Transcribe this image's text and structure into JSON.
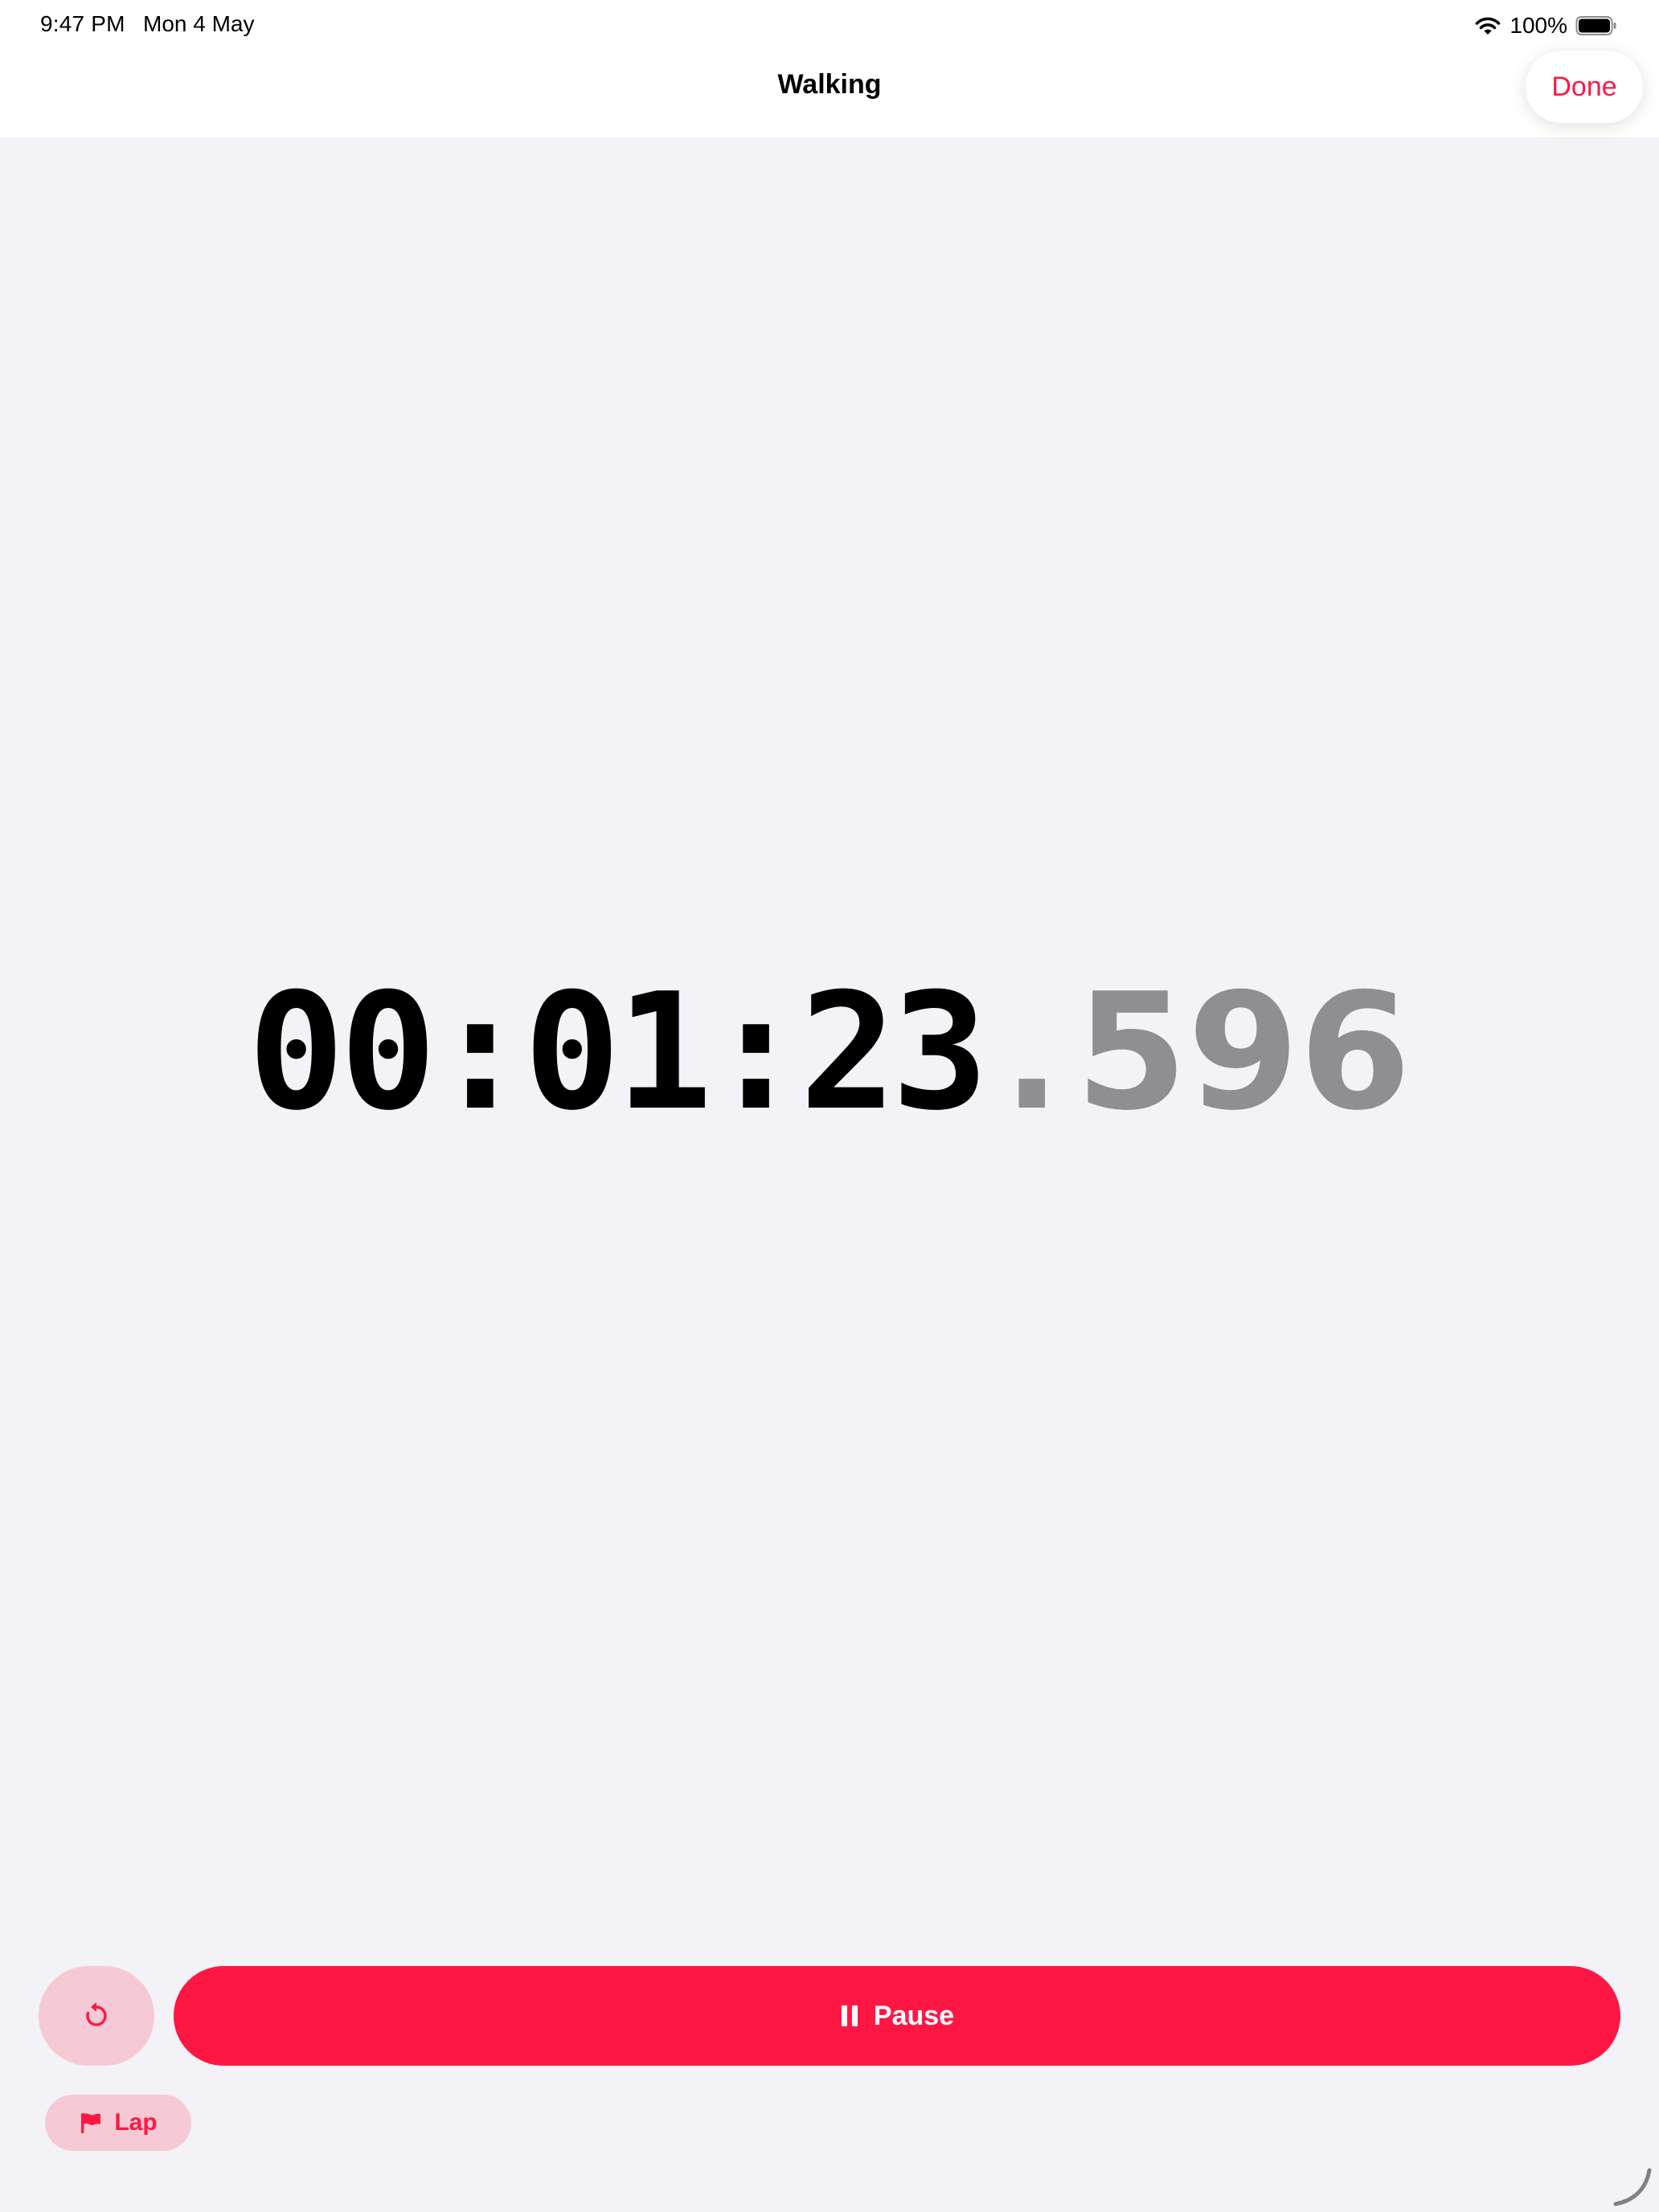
{
  "status_bar": {
    "time": "9:47 PM",
    "date": "Mon 4 May",
    "battery": "100%",
    "wifi_icon": "wifi-icon",
    "battery_icon": "battery-full-icon"
  },
  "nav": {
    "title": "Walking",
    "done_label": "Done"
  },
  "timer": {
    "main": "00:01:23",
    "separator": ".",
    "fraction": "596"
  },
  "controls": {
    "reset_icon": "reset-icon",
    "pause_label": "Pause",
    "pause_icon": "pause-icon",
    "lap_label": "Lap",
    "lap_icon": "flag-icon"
  },
  "colors": {
    "accent": "#ff1744",
    "accent_soft": "#f5cad5",
    "background": "#f2f2f7",
    "secondary_text": "#8e8e93"
  }
}
